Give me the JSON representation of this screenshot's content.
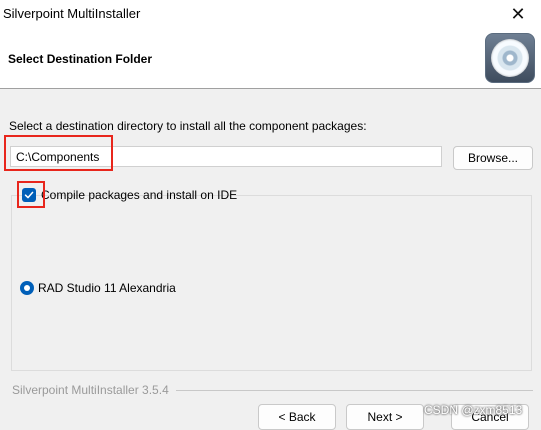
{
  "window": {
    "title": "Silverpoint MultiInstaller",
    "close_symbol": "✕"
  },
  "header": {
    "title": "Select Destination Folder",
    "icon": "cd-disc-icon"
  },
  "destination": {
    "label": "Select a destination directory to install all the component packages:",
    "path_value": "C:\\Components",
    "browse_label": "Browse..."
  },
  "options": {
    "compile_label": "Compile packages and install on IDE",
    "compile_checked": true,
    "ide_option_label": "RAD Studio 11 Alexandria",
    "ide_option_selected": true
  },
  "footer": {
    "version_text": "Silverpoint MultiInstaller 3.5.4",
    "back_label": "< Back",
    "next_label": "Next >",
    "cancel_label": "Cancel"
  },
  "watermark": {
    "text": "CSDN @zxm8513"
  },
  "colors": {
    "accent": "#005fb8",
    "annotation": "#e8261c"
  }
}
